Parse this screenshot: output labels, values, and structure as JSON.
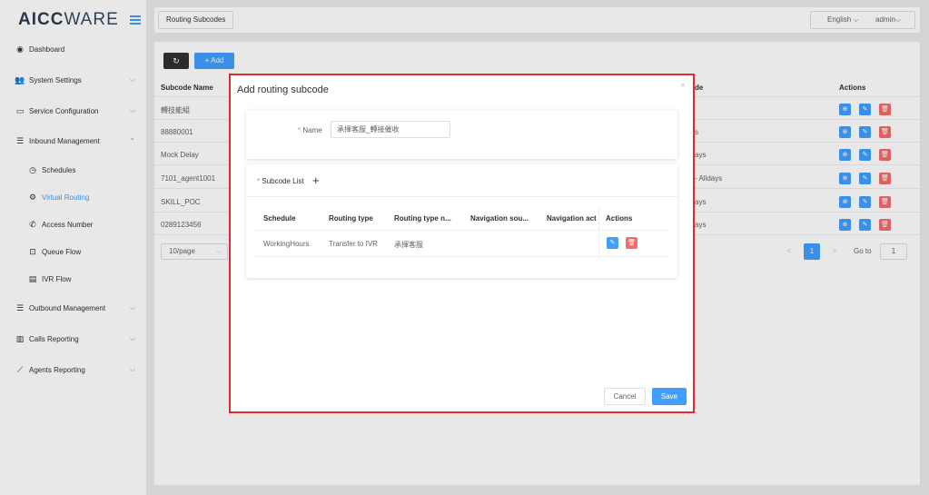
{
  "app": {
    "logo_bold": "AICC",
    "logo_light": "WARE",
    "accent": "#409eff",
    "danger": "#f56c6c",
    "highlight_border": "#e8262b"
  },
  "sidebar": {
    "items": [
      {
        "label": "Dashboard",
        "icon": "dashboard-icon",
        "glyph": "◉"
      },
      {
        "label": "System Settings",
        "icon": "users-icon",
        "glyph": "👥",
        "chevron": "⌵"
      },
      {
        "label": "Service Configuration",
        "icon": "id-card-icon",
        "glyph": "▭",
        "chevron": "⌵"
      },
      {
        "label": "Inbound Management",
        "icon": "list-icon",
        "glyph": "☰",
        "chevron": "⌃"
      },
      {
        "label": "Schedules",
        "icon": "clock-icon",
        "glyph": "◷"
      },
      {
        "label": "Virtual Routing",
        "icon": "gear-icon",
        "glyph": "⚙"
      },
      {
        "label": "Access Number",
        "icon": "phone-icon",
        "glyph": "✆"
      },
      {
        "label": "Queue Flow",
        "icon": "inbox-icon",
        "glyph": "⊡"
      },
      {
        "label": "IVR Flow",
        "icon": "film-icon",
        "glyph": "▤"
      },
      {
        "label": "Outbound Management",
        "icon": "list-icon",
        "glyph": "☰",
        "chevron": "⌵"
      },
      {
        "label": "Calls Reporting",
        "icon": "bar-chart-icon",
        "glyph": "▥",
        "chevron": "⌵"
      },
      {
        "label": "Agents Reporting",
        "icon": "line-chart-icon",
        "glyph": "⟋",
        "chevron": "⌵"
      }
    ]
  },
  "header": {
    "breadcrumb": "Routing Subcodes",
    "language": "English ⌵",
    "user": "admin⌵"
  },
  "toolbar": {
    "refresh_glyph": "↻",
    "add_label": "+ Add"
  },
  "table": {
    "headers": {
      "name": "Subcode Name",
      "partial": "de",
      "actions": "Actions"
    },
    "rows": [
      {
        "name": "轉技能組",
        "right": ""
      },
      {
        "name": "88880001",
        "right": "s"
      },
      {
        "name": "Mock Delay",
        "right": "ays"
      },
      {
        "name": "7101_agent1001",
        "right": "- Alldays"
      },
      {
        "name": "SKILL_POC",
        "right": "ays"
      },
      {
        "name": "0289123456",
        "right": "ays"
      }
    ],
    "action_glyphs": {
      "view": "⊕",
      "edit": "✎",
      "delete": "🗑"
    }
  },
  "pagination": {
    "page_size": "10/page",
    "page_size_chevron": "⌵",
    "prev": "<",
    "current": "1",
    "next": ">",
    "goto_label": "Go to",
    "goto_value": "1"
  },
  "dialog": {
    "title": "Add routing subcode",
    "close": "×",
    "required_mark": "*",
    "name_label": "Name",
    "name_value": "承揮客服_轉接催收",
    "subcode_list_label": "Subcode List",
    "add_glyph": "+",
    "columns": [
      "Schedule",
      "Routing type",
      "Routing type n...",
      "Navigation sou...",
      "Navigation act",
      "Actions"
    ],
    "row": {
      "schedule": "WorkingHours",
      "routing_type": "Transfer to IVR",
      "routing_type_name": "承揮客服",
      "navigation_source": "",
      "navigation_action": ""
    },
    "cancel_label": "Cancel",
    "save_label": "Save"
  }
}
